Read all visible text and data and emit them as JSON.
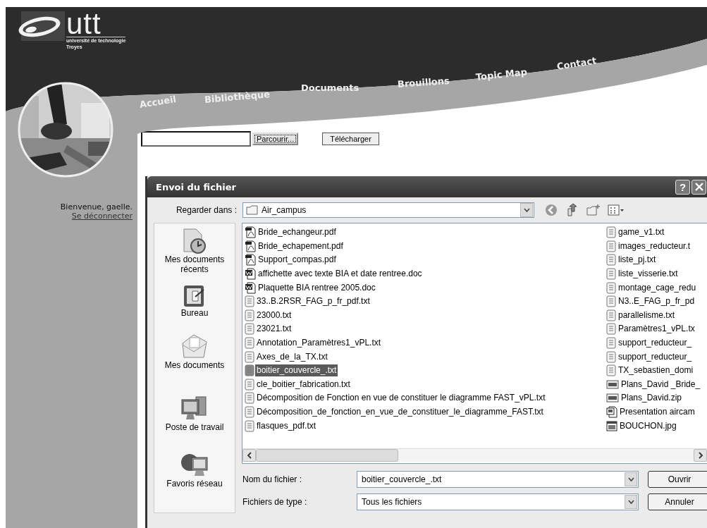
{
  "site": {
    "logo_text": "utt",
    "logo_subtitle": "université de technologie",
    "logo_city": "Troyes"
  },
  "nav": [
    {
      "label": "Accueil"
    },
    {
      "label": "Bibliothèque"
    },
    {
      "label": "Documents"
    },
    {
      "label": "Brouillons"
    },
    {
      "label": "Topic Map"
    },
    {
      "label": "Contact"
    }
  ],
  "upload": {
    "browse_button": "Parcourir...",
    "upload_button": "Télécharger"
  },
  "user": {
    "greeting": "Bienvenue, gaelle.",
    "logout_link": "Se déconnecter"
  },
  "dialog": {
    "title": "Envoi du fichier",
    "help_button": "?",
    "look_in_label": "Regarder dans :",
    "look_in_value": "Air_campus",
    "places": [
      {
        "kind": "recent",
        "label": "Mes documents récents"
      },
      {
        "kind": "desktop",
        "label": "Bureau"
      },
      {
        "kind": "documents",
        "label": "Mes documents"
      },
      {
        "kind": "computer",
        "label": "Poste de travail"
      },
      {
        "kind": "network",
        "label": "Favoris réseau"
      }
    ],
    "files": [
      {
        "kind": "pdf",
        "name": "Bride_echangeur.pdf",
        "selected": false
      },
      {
        "kind": "pdf",
        "name": "Bride_echapement.pdf",
        "selected": false
      },
      {
        "kind": "pdf",
        "name": "Support_compas.pdf",
        "selected": false
      },
      {
        "kind": "doc",
        "name": "affichette avec texte BIA et date rentree.doc",
        "selected": false
      },
      {
        "kind": "doc",
        "name": "Plaquette BIA rentree 2005.doc",
        "selected": false
      },
      {
        "kind": "txt",
        "name": "33..B.2RSR_FAG_p_fr_pdf.txt",
        "selected": false
      },
      {
        "kind": "txt",
        "name": "23000.txt",
        "selected": false
      },
      {
        "kind": "txt",
        "name": "23021.txt",
        "selected": false
      },
      {
        "kind": "txt",
        "name": "Annotation_Paramètres1_vPL.txt",
        "selected": false
      },
      {
        "kind": "txt",
        "name": "Axes_de_la_TX.txt",
        "selected": false
      },
      {
        "kind": "txt",
        "name": "boitier_couvercle_.txt",
        "selected": true
      },
      {
        "kind": "txt",
        "name": "cle_boitier_fabrication.txt",
        "selected": false
      },
      {
        "kind": "txt",
        "name": "Décomposition de Fonction en vue de constituer le diagramme FAST_vPL.txt",
        "selected": false
      },
      {
        "kind": "txt",
        "name": "Décomposition_de_fonction_en_vue_de_constituer_le_diagramme_FAST.txt",
        "selected": false
      },
      {
        "kind": "txt",
        "name": "flasques_pdf.txt",
        "selected": false
      },
      {
        "kind": "txt",
        "name": "game_v1.txt",
        "selected": false
      },
      {
        "kind": "txt",
        "name": "images_reducteur.t",
        "selected": false
      },
      {
        "kind": "txt",
        "name": "liste_pj.txt",
        "selected": false
      },
      {
        "kind": "txt",
        "name": "liste_visserie.txt",
        "selected": false
      },
      {
        "kind": "txt",
        "name": "montage_cage_redu",
        "selected": false
      },
      {
        "kind": "txt",
        "name": "N3..E_FAG_p_fr_pd",
        "selected": false
      },
      {
        "kind": "txt",
        "name": "parallelisme.txt",
        "selected": false
      },
      {
        "kind": "txt",
        "name": "Paramètres1_vPL.tx",
        "selected": false
      },
      {
        "kind": "txt",
        "name": "support_reducteur_",
        "selected": false
      },
      {
        "kind": "txt",
        "name": "support_reducteur_",
        "selected": false
      },
      {
        "kind": "txt",
        "name": "TX_sebastien_domi",
        "selected": false
      },
      {
        "kind": "zip",
        "name": "Plans_David _Bride_",
        "selected": false
      },
      {
        "kind": "zip",
        "name": "Plans_David.zip",
        "selected": false
      },
      {
        "kind": "ppt",
        "name": "Presentation aircam",
        "selected": false
      },
      {
        "kind": "jpg",
        "name": "BOUCHON.jpg",
        "selected": false
      }
    ],
    "filename_label": "Nom du fichier :",
    "filename_value": "boitier_couvercle_.txt",
    "filetype_label": "Fichiers de type :",
    "filetype_value": "Tous les fichiers",
    "buttons": [
      "Ouvrir",
      "Annuler"
    ]
  }
}
